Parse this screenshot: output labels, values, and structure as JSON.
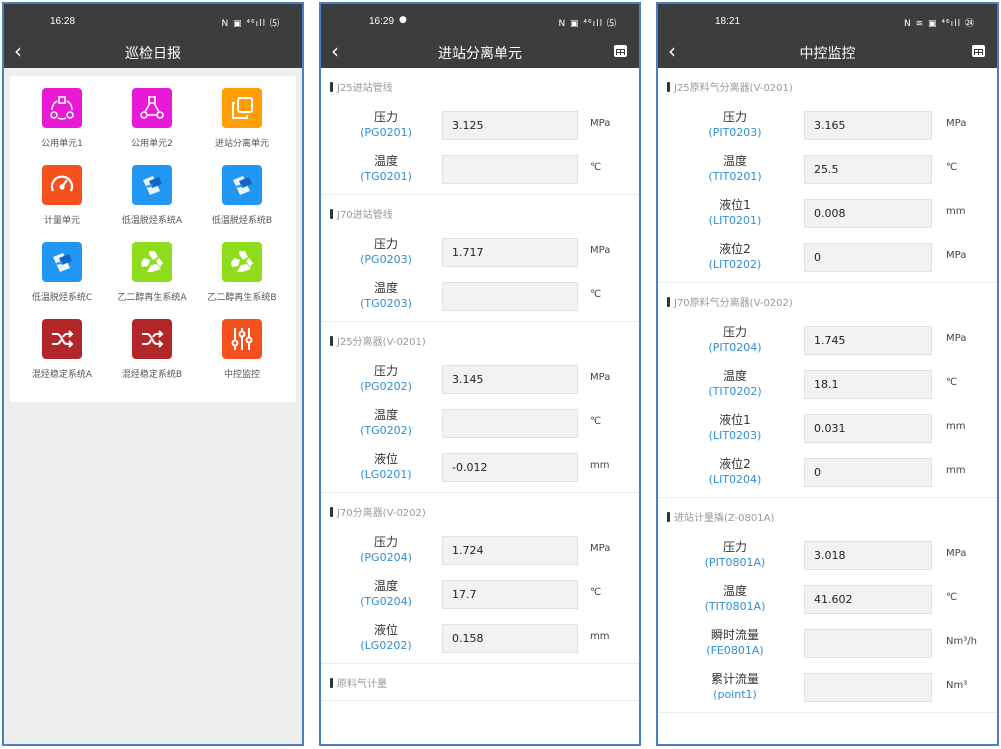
{
  "screen1": {
    "time": "16:28",
    "status_icons": "N ▣ ⁴⁶ıll ⑸",
    "title": "巡检日报",
    "back": "‹",
    "items": [
      {
        "label": "公用单元1",
        "icon": "circle-nodes-icon",
        "color": "#e81ad8"
      },
      {
        "label": "公用单元2",
        "icon": "triangle-nodes-icon",
        "color": "#e81ad8"
      },
      {
        "label": "进站分离单元",
        "icon": "copy-icon",
        "color": "#ff9f05"
      },
      {
        "label": "计量单元",
        "icon": "gauge-icon",
        "color": "#f4511e"
      },
      {
        "label": "低温脱烃系统A",
        "icon": "edit-doc-icon",
        "color": "#2196f3"
      },
      {
        "label": "低温脱烃系统B",
        "icon": "edit-doc-icon",
        "color": "#2196f3"
      },
      {
        "label": "低温脱烃系统C",
        "icon": "edit-doc-icon",
        "color": "#2196f3"
      },
      {
        "label": "乙二醇再生系统A",
        "icon": "recycle-icon",
        "color": "#8edc1c"
      },
      {
        "label": "乙二醇再生系统B",
        "icon": "recycle-icon",
        "color": "#8edc1c"
      },
      {
        "label": "混烃稳定系统A",
        "icon": "shuffle-icon",
        "color": "#b2262a"
      },
      {
        "label": "混烃稳定系统B",
        "icon": "shuffle-icon",
        "color": "#b2262a"
      },
      {
        "label": "中控监控",
        "icon": "sliders-icon",
        "color": "#f4511e"
      }
    ]
  },
  "screen2": {
    "time": "16:29",
    "status_icons": "N ▣ ⁴⁶ıll ⑸",
    "title": "进站分离单元",
    "back": "‹",
    "sections": [
      {
        "title": "J25进站管线",
        "rows": [
          {
            "label": "压力",
            "tag": "(PG0201)",
            "value": "3.125",
            "unit": "MPa"
          },
          {
            "label": "温度",
            "tag": "(TG0201)",
            "value": "",
            "unit": "℃"
          }
        ]
      },
      {
        "title": "J70进站管线",
        "rows": [
          {
            "label": "压力",
            "tag": "(PG0203)",
            "value": "1.717",
            "unit": "MPa"
          },
          {
            "label": "温度",
            "tag": "(TG0203)",
            "value": "",
            "unit": "℃"
          }
        ]
      },
      {
        "title": "J25分离器(V-0201)",
        "rows": [
          {
            "label": "压力",
            "tag": "(PG0202)",
            "value": "3.145",
            "unit": "MPa"
          },
          {
            "label": "温度",
            "tag": "(TG0202)",
            "value": "",
            "unit": "℃"
          },
          {
            "label": "液位",
            "tag": "(LG0201)",
            "value": "-0.012",
            "unit": "mm"
          }
        ]
      },
      {
        "title": "J70分离器(V-0202)",
        "rows": [
          {
            "label": "压力",
            "tag": "(PG0204)",
            "value": "1.724",
            "unit": "MPa"
          },
          {
            "label": "温度",
            "tag": "(TG0204)",
            "value": "17.7",
            "unit": "℃"
          },
          {
            "label": "液位",
            "tag": "(LG0202)",
            "value": "0.158",
            "unit": "mm"
          }
        ]
      },
      {
        "title": "原料气计量",
        "rows": []
      }
    ]
  },
  "screen3": {
    "time": "18:21",
    "status_icons": "N ≋ ▣ ⁴⁶ıll ㉔",
    "title": "中控监控",
    "back": "‹",
    "sections": [
      {
        "title": "J25原料气分离器(V-0201)",
        "rows": [
          {
            "label": "压力",
            "tag": "(PIT0203)",
            "value": "3.165",
            "unit": "MPa"
          },
          {
            "label": "温度",
            "tag": "(TIT0201)",
            "value": "25.5",
            "unit": "℃"
          },
          {
            "label": "液位1",
            "tag": "(LIT0201)",
            "value": "0.008",
            "unit": "mm"
          },
          {
            "label": "液位2",
            "tag": "(LIT0202)",
            "value": "0",
            "unit": "MPa"
          }
        ]
      },
      {
        "title": "J70原料气分离器(V-0202)",
        "rows": [
          {
            "label": "压力",
            "tag": "(PIT0204)",
            "value": "1.745",
            "unit": "MPa"
          },
          {
            "label": "温度",
            "tag": "(TIT0202)",
            "value": "18.1",
            "unit": "℃"
          },
          {
            "label": "液位1",
            "tag": "(LIT0203)",
            "value": "0.031",
            "unit": "mm"
          },
          {
            "label": "液位2",
            "tag": "(LIT0204)",
            "value": "0",
            "unit": "mm"
          }
        ]
      },
      {
        "title": "进站计量撬(Z-0801A)",
        "rows": [
          {
            "label": "压力",
            "tag": "(PIT0801A)",
            "value": "3.018",
            "unit": "MPa"
          },
          {
            "label": "温度",
            "tag": "(TIT0801A)",
            "value": "41.602",
            "unit": "℃"
          },
          {
            "label": "瞬时流量",
            "tag": "(FE0801A)",
            "value": "",
            "unit": "Nm³/h"
          },
          {
            "label": "累计流量",
            "tag": "(point1)",
            "value": "",
            "unit": "Nm³"
          }
        ]
      }
    ]
  }
}
